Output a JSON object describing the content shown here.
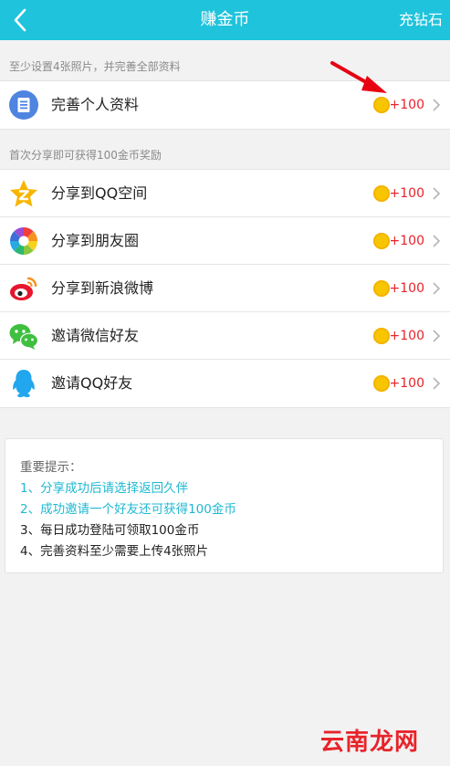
{
  "header": {
    "title": "赚金币",
    "right_action": "充钻石"
  },
  "section1": {
    "label": "至少设置4张照片，并完善全部资料",
    "items": [
      {
        "label": "完善个人资料",
        "reward": "+100",
        "icon": "profile-doc-icon"
      }
    ]
  },
  "section2": {
    "label": "首次分享即可获得100金币奖励",
    "items": [
      {
        "label": "分享到QQ空间",
        "reward": "+100",
        "icon": "qzone-star-icon"
      },
      {
        "label": "分享到朋友圈",
        "reward": "+100",
        "icon": "moments-aperture-icon"
      },
      {
        "label": "分享到新浪微博",
        "reward": "+100",
        "icon": "weibo-icon"
      },
      {
        "label": "邀请微信好友",
        "reward": "+100",
        "icon": "wechat-icon"
      },
      {
        "label": "邀请QQ好友",
        "reward": "+100",
        "icon": "qq-penguin-icon"
      }
    ]
  },
  "tips": {
    "title": "重要提示：",
    "lines": [
      "1、分享成功后请选择返回久伴",
      "2、成功邀请一个好友还可获得100金币",
      "3、每日成功登陆可领取100金币",
      "4、完善资料至少需要上传4张照片"
    ]
  },
  "watermark": "云南龙网",
  "colors": {
    "header": "#1fc3dc",
    "reward": "#e8232a",
    "coin": "#f7c600",
    "tip_highlight": "#1fb8d2"
  }
}
